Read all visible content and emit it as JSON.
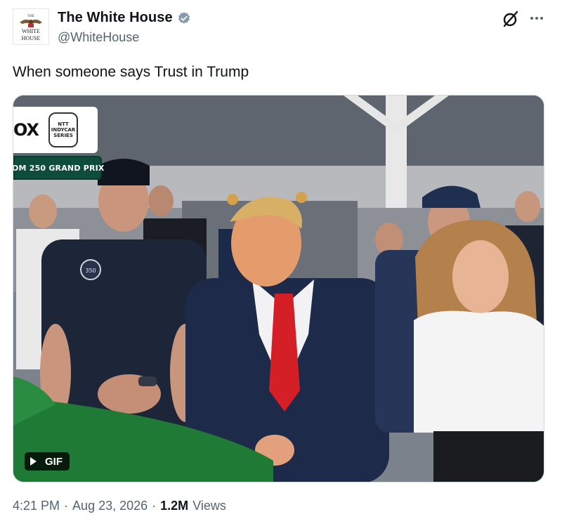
{
  "account": {
    "display_name": "The White House",
    "handle": "@WhiteHouse",
    "avatar_label_top": "THE",
    "avatar_label_mid": "WHITE",
    "avatar_label_bottom": "HOUSE",
    "verified_icon": "verified-badge-icon"
  },
  "header_actions": {
    "grok_icon": "grok-icon",
    "more_icon": "more-options-icon"
  },
  "tweet": {
    "text": "When someone says Trust in Trump"
  },
  "media": {
    "broadcaster_text": "OX",
    "indycar_badge_top": "NTT",
    "indycar_badge_mid": "INDYCAR",
    "indycar_badge_bottom": "SERIES",
    "race_banner_text": "OM 250 GRAND PRIX",
    "gif_label": "GIF",
    "play_icon": "play-icon",
    "shirt_logo_text": "350"
  },
  "footer": {
    "time": "4:21 PM",
    "separator": "·",
    "date": "Aug 23, 2026",
    "views_count": "1.2M",
    "views_label": "Views"
  },
  "colors": {
    "text_primary": "#0f1419",
    "text_secondary": "#536471",
    "verified": "#829aab",
    "banner_green": "#0e4d3a"
  }
}
